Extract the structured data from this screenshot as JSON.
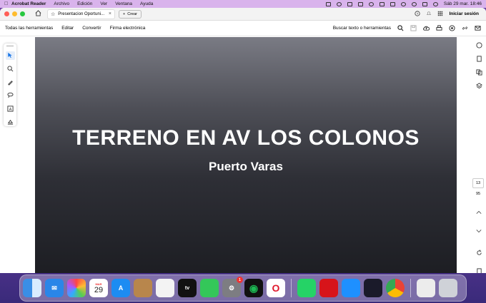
{
  "menubar": {
    "app": "Acrobat Reader",
    "items": [
      "Archivo",
      "Edición",
      "Ver",
      "Ventana",
      "Ayuda"
    ],
    "clock": "Sáb 29 mar.  18:46"
  },
  "titlebar": {
    "tab_title": "Presentacion Oportuni...",
    "new_tab_label": "Crear",
    "signin_label": "Iniciar sesión"
  },
  "toolbar": {
    "tools": [
      "Todas las herramientas",
      "Editar",
      "Convertir",
      "Firma electrónica"
    ],
    "search_label": "Buscar texto o herramientas"
  },
  "document": {
    "title": "TERRENO EN AV LOS COLONOS",
    "subtitle": "Puerto Varas"
  },
  "pager": {
    "current": "13",
    "total": "95"
  },
  "dock": {
    "calendar_month": "MAR",
    "calendar_day": "29",
    "tv_label": "tv",
    "settings_badge": "1"
  },
  "colors": {
    "accent": "#1473e6",
    "menubar_bg": "#d9b3ec",
    "slide_top": "#7a7b84",
    "slide_bottom": "#1d1e23"
  }
}
